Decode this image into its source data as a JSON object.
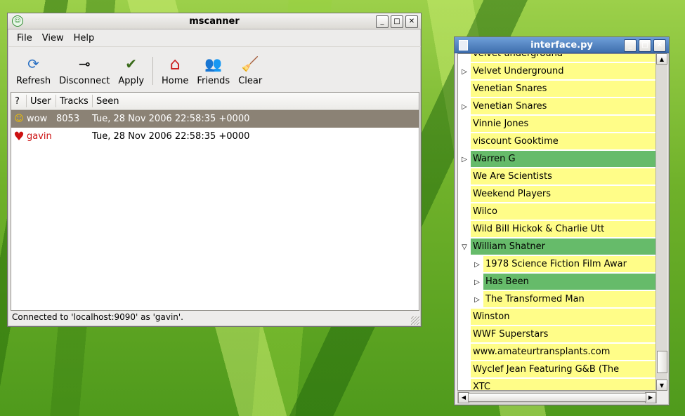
{
  "mscanner": {
    "title": "mscanner",
    "controls": {
      "minimize": "_",
      "maximize": "□",
      "close": "✕"
    },
    "menu": [
      "File",
      "View",
      "Help"
    ],
    "toolbar": [
      {
        "label": "Refresh",
        "icon": "refresh-icon",
        "glyph": "⟳"
      },
      {
        "label": "Disconnect",
        "icon": "plug-icon",
        "glyph": "⊸"
      },
      {
        "label": "Apply",
        "icon": "checkmark-icon",
        "glyph": "✔"
      },
      {
        "label": "Home",
        "icon": "home-icon",
        "glyph": "⌂"
      },
      {
        "label": "Friends",
        "icon": "people-icon",
        "glyph": "👥"
      },
      {
        "label": "Clear",
        "icon": "broom-icon",
        "glyph": "🧹"
      }
    ],
    "columns": [
      "?",
      "User",
      "Tracks",
      "Seen"
    ],
    "rows": [
      {
        "icon": "smiley-icon",
        "glyph": "☺",
        "user": "wow",
        "tracks": "8053",
        "seen": "Tue, 28 Nov 2006 22:58:35 +0000"
      },
      {
        "icon": "heart-icon",
        "glyph": "♥",
        "user": "gavin",
        "tracks": "",
        "seen": "Tue, 28 Nov 2006 22:58:35 +0000"
      }
    ],
    "status": "Connected to 'localhost:9090' as 'gavin'."
  },
  "iface": {
    "title": "interface.py",
    "controls": {
      "minimize": "_",
      "maximize": "□",
      "close": "✕"
    },
    "rows": [
      {
        "label": "velvet underground",
        "expander": "",
        "green": false,
        "child": false
      },
      {
        "label": "Velvet Underground",
        "expander": "▷",
        "green": false,
        "child": false
      },
      {
        "label": "Venetian Snares",
        "expander": "",
        "green": false,
        "child": false
      },
      {
        "label": "Venetian Snares",
        "expander": "▷",
        "green": false,
        "child": false
      },
      {
        "label": "Vinnie Jones",
        "expander": "",
        "green": false,
        "child": false
      },
      {
        "label": "viscount Gooktime",
        "expander": "",
        "green": false,
        "child": false
      },
      {
        "label": "Warren G",
        "expander": "▷",
        "green": true,
        "child": false
      },
      {
        "label": "We Are Scientists",
        "expander": "",
        "green": false,
        "child": false
      },
      {
        "label": "Weekend Players",
        "expander": "",
        "green": false,
        "child": false
      },
      {
        "label": "Wilco",
        "expander": "",
        "green": false,
        "child": false
      },
      {
        "label": "Wild Bill Hickok & Charlie Utt",
        "expander": "",
        "green": false,
        "child": false
      },
      {
        "label": "William Shatner",
        "expander": "▽",
        "green": true,
        "child": false
      },
      {
        "label": "1978 Science Fiction Film Awar",
        "expander": "▷",
        "green": false,
        "child": true
      },
      {
        "label": "Has Been",
        "expander": "▷",
        "green": true,
        "child": true
      },
      {
        "label": "The Transformed Man",
        "expander": "▷",
        "green": false,
        "child": true
      },
      {
        "label": "Winston",
        "expander": "",
        "green": false,
        "child": false
      },
      {
        "label": "WWF Superstars",
        "expander": "",
        "green": false,
        "child": false
      },
      {
        "label": "www.amateurtransplants.com",
        "expander": "",
        "green": false,
        "child": false
      },
      {
        "label": "Wyclef Jean Featuring G&B (The",
        "expander": "",
        "green": false,
        "child": false
      },
      {
        "label": "XTC",
        "expander": "",
        "green": false,
        "child": false
      }
    ],
    "scroll": {
      "up": "▲",
      "down": "▼",
      "left": "◀",
      "right": "▶"
    }
  }
}
